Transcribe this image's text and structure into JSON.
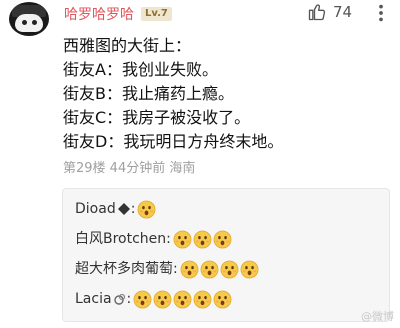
{
  "user": {
    "name": "哈罗哈罗哈",
    "level": "Lv.7"
  },
  "likes": {
    "count": "74"
  },
  "post": {
    "lines": [
      "西雅图的大街上：",
      "街友A：我创业失败。",
      "街友B：我止痛药上瘾。",
      "街友C：我房子被没收了。",
      "街友D：我玩明日方舟终末地。"
    ]
  },
  "meta": {
    "text": "第29楼 44分钟前 海南"
  },
  "replies": [
    {
      "name": "Dioad",
      "emoji_count": 1
    },
    {
      "name": "白风Brotchen",
      "emoji_count": 3
    },
    {
      "name": "超大杯多肉葡萄",
      "emoji_count": 4
    },
    {
      "name": "Lacia",
      "emoji_count": 5
    }
  ],
  "watermark": "@微博"
}
